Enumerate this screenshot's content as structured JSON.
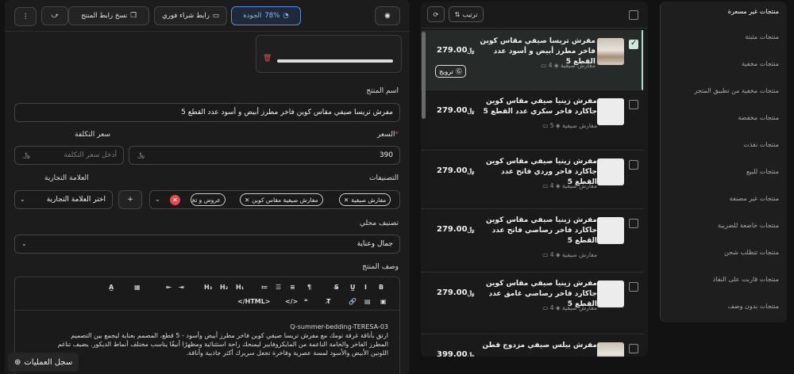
{
  "filters": {
    "items": [
      {
        "label": "منتجات غير مسعرة",
        "active": true
      },
      {
        "label": "منتجات مثبتة"
      },
      {
        "label": "منتجات مخفية"
      },
      {
        "label": "منتجات مخفية من تطبيق المتجر"
      },
      {
        "label": "منتجات مخفضة"
      },
      {
        "label": "منتجات نفذت"
      },
      {
        "label": "منتجات للبيع"
      },
      {
        "label": "منتجات غير مصنفة"
      },
      {
        "label": "منتجات خاضعة للضريبة"
      },
      {
        "label": "منتجات تتطلب شحن"
      },
      {
        "label": "منتجات قاربت على النفاذ"
      },
      {
        "label": "منتجات بدون وصف"
      }
    ]
  },
  "product_list": {
    "sort_label": "ترتيب",
    "promote_label": "ترويج",
    "currency": "﷼",
    "products": [
      {
        "title": "مفرش تريسا صيفي مقاس كوين فاخر مطرز أبيض و أسود عدد القطع 5",
        "price": "279.00",
        "category": "مفارش صيفية",
        "count": "4",
        "selected": true
      },
      {
        "title": "مفرش زينيا صيفي مقاس كوين جاكارد فاخر سكري عدد القطع 5",
        "price": "279.00",
        "category": "مفارش صيفية",
        "count": "5"
      },
      {
        "title": "مفرش زينيا صيفي مقاس كوين جاكارد فاخر وردي فاتح عدد القطع 5",
        "price": "279.00",
        "category": "مفارش صيفية",
        "count": "4"
      },
      {
        "title": "مفرش زينيا صيفي مقاس كوين جاكارد فاخر رصاصي فاتح عدد القطع 5",
        "price": "279.00",
        "category": "مفارش صيفية",
        "count": "4"
      },
      {
        "title": "مفرش زينيا صيفي مقاس كوين جاكارد فاخر رصاصي غامق عدد القطع 5",
        "price": "279.00",
        "category": "مفارش صيفية",
        "count": "4"
      },
      {
        "title": "مفرش بيلس صيفي مزدوج قطن",
        "price": "399.00",
        "category": "",
        "count": ""
      }
    ]
  },
  "toolbar": {
    "quality_label": "الجودة",
    "quality_value": "78%",
    "quick_buy_label": "رابط شراء فوري",
    "copy_link_label": "نسخ رابط المنتج"
  },
  "form": {
    "name_label": "اسم المنتج",
    "name_value": "مفرش تريسا  صيفي  مقاس كوين  فاخر مطرز أبيض و أسود عدد القطع 5",
    "price_label": "السعر",
    "price_required": "*",
    "price_value": "390",
    "cost_label": "سعر التكلفة",
    "cost_placeholder": "أدخل سعر التكلفة",
    "categories_label": "التصنيفات",
    "categories": [
      "مفارش صيفية",
      "مفارش صيفية مقاس كوين",
      "عروض و تخفي"
    ],
    "brand_label": "العلامة التجارية",
    "brand_placeholder": "اختر العلامة التجارية",
    "local_label": "تصنيف محلي",
    "local_value": "جمال وعناية",
    "desc_label": "وصف المنتج",
    "html_label": "</HTML>",
    "desc_lines": [
      "Q-summer-bedding-TERESA-03",
      "ارتقِ بأناقة غرفة نومك مع مفرش تريسا صيفي كوين فاخر مطرز أبيض وأسود - 5 قطع، المصمم بعناية ليجمع بين التصميم",
      "المطرز الفاخر والخامة الناعمة من المايكروفايبر ليمنحك راحة استثنائية ومظهرًا أنيقًا يناسب مختلف أنماط الديكور. يضيف تناغم",
      "اللونين الأبيض والأسود لمسة عصرية وفاخرة تجعل سريرك أكثر جاذبية وأناقة."
    ]
  },
  "activity_log_label": "سجل العمليات",
  "colors": {
    "accent": "#a7e3c7",
    "quality": "#5b8fd6",
    "danger": "#e24c4c"
  }
}
